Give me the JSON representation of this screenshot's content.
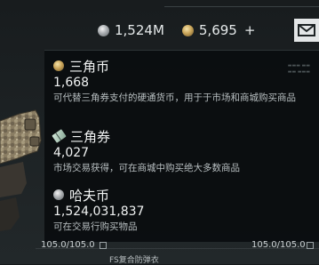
{
  "top_bar": {
    "haf_coin_total": "1,524M",
    "sanjiao_coin_total": "5,695",
    "add_label": "+"
  },
  "tooltip": {
    "entries": [
      {
        "icon": "gold-coin-icon",
        "name": "三角币",
        "amount": "1,668",
        "description": "可代替三角券支付的硬通货币，用于于市场和商城购买商品"
      },
      {
        "icon": "ticket-icon",
        "name": "三角券",
        "amount": "4,027",
        "description": "市场交易获得，可在商城中购买绝大多数商品"
      },
      {
        "icon": "silver-coin-icon",
        "name": "哈夫币",
        "amount": "1,524,031,837",
        "description": "可在交易行购买物品"
      }
    ]
  },
  "bottom": {
    "durability_left": "105.0/105.0",
    "durability_right": "105.0/105.0",
    "item_name": "FS复合防弹衣"
  },
  "colors": {
    "panel_bg": "#0a0d0f",
    "text_primary": "#f0f2f2",
    "text_secondary": "#b7bec0",
    "gold": "#c9a55a",
    "silver": "#a9adb0"
  }
}
